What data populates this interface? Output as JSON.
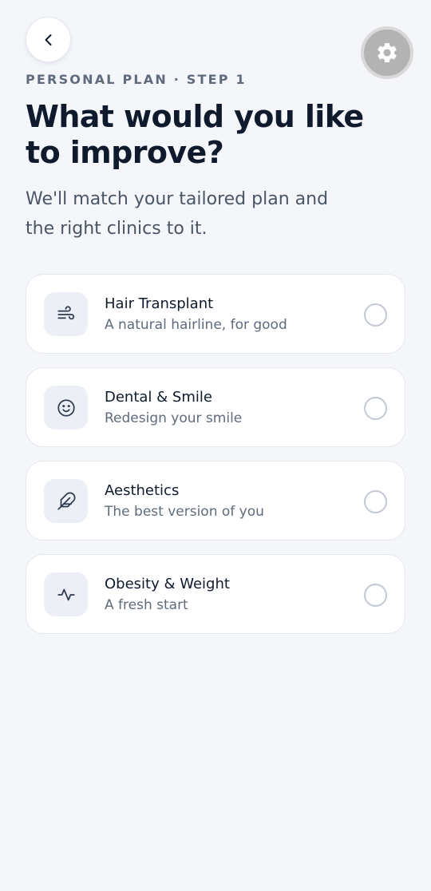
{
  "header": {
    "back_icon": "chevron-left-icon",
    "settings_icon": "gear-icon"
  },
  "eyebrow": "PERSONAL PLAN · STEP 1",
  "title": "What would you like to improve?",
  "subtitle": "We'll match your tailored plan and the right clinics to it.",
  "options": [
    {
      "icon": "wind-icon",
      "title": "Hair Transplant",
      "description": "A natural hairline, for good",
      "selected": false
    },
    {
      "icon": "smile-icon",
      "title": "Dental & Smile",
      "description": "Redesign your smile",
      "selected": false
    },
    {
      "icon": "feather-icon",
      "title": "Aesthetics",
      "description": "The best version of you",
      "selected": false
    },
    {
      "icon": "activity-icon",
      "title": "Obesity & Weight",
      "description": "A fresh start",
      "selected": false
    }
  ],
  "colors": {
    "background": "#f4f6fa",
    "card": "#ffffff",
    "text_primary": "#0f1b2d",
    "text_secondary": "#5f6b7c",
    "icon_tile": "#eceff5",
    "settings_button": "#b3b3b3"
  }
}
